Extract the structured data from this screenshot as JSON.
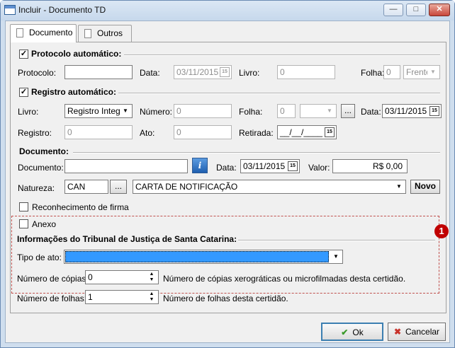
{
  "window": {
    "title": "Incluir - Documento TD"
  },
  "tabs": [
    "Documento",
    "Outros"
  ],
  "protocolo": {
    "section_label": "Protocolo automático:",
    "checked": true,
    "protocolo_label": "Protocolo:",
    "protocolo_value": "",
    "data_label": "Data:",
    "data_value": "03/11/2015",
    "livro_label": "Livro:",
    "livro_value": "0",
    "folha_label": "Folha:",
    "folha_value": "0",
    "folha_side": "Frente"
  },
  "registro": {
    "section_label": "Registro automático:",
    "checked": true,
    "livro_label": "Livro:",
    "livro_value": "Registro Integr",
    "numero_label": "Número:",
    "numero_value": "0",
    "folha_label": "Folha:",
    "folha_value": "0",
    "folha_side": "",
    "more_label": "...",
    "data_label": "Data:",
    "data_value": "03/11/2015",
    "registro_label": "Registro:",
    "registro_value": "0",
    "ato_label": "Ato:",
    "ato_value": "0",
    "retirada_label": "Retirada:",
    "retirada_value": "__/__/____"
  },
  "documento": {
    "section_label": "Documento:",
    "documento_label": "Documento:",
    "documento_value": "",
    "info_label": "i",
    "data_label": "Data:",
    "data_value": "03/11/2015",
    "valor_label": "Valor:",
    "valor_value": "R$ 0,00",
    "natureza_label": "Natureza:",
    "natureza_code": "CAN",
    "natureza_more": "...",
    "natureza_desc": "CARTA DE NOTIFICAÇÃO",
    "novo_label": "Novo",
    "reconhecimento_label": "Reconhecimento de firma",
    "reconhecimento_checked": false,
    "anexo_label": "Anexo",
    "anexo_checked": false
  },
  "tj": {
    "section_label": "Informações do Tribunal de Justiça de Santa Catarina:",
    "badge": "1",
    "tipo_label": "Tipo de ato:",
    "tipo_value": "",
    "copias_label": "Número de cópias:",
    "copias_value": "0",
    "copias_desc": "Número de cópias xerográticas ou microfilmadas desta certidão.",
    "folhas_label": "Número de folhas:",
    "folhas_value": "1",
    "folhas_desc": "Número de folhas desta certidão."
  },
  "buttons": {
    "ok": "Ok",
    "cancel": "Cancelar"
  },
  "icons": {
    "ok": "check-icon",
    "cancel": "x-icon",
    "window": "window-icon",
    "calendar": "calendar-icon",
    "info": "info-icon"
  },
  "colors": {
    "selection": "#3399ff",
    "badge": "#c00000",
    "ok_check": "#3a9a2a",
    "cancel_x": "#c8322a"
  }
}
